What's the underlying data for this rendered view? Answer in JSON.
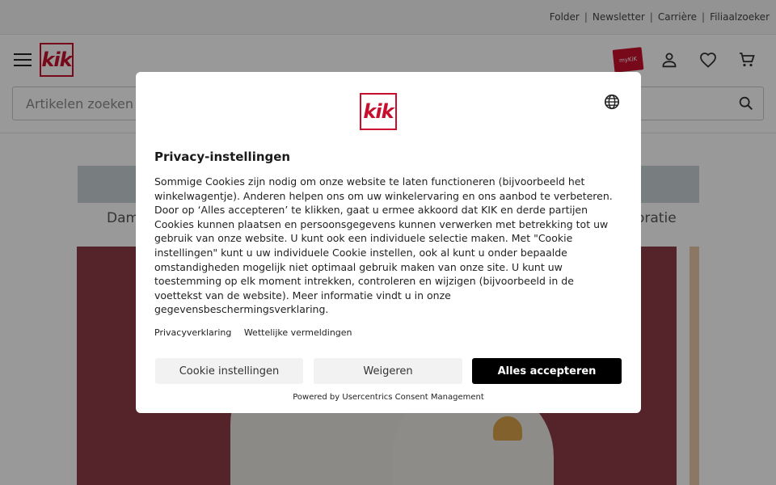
{
  "topbar": {
    "links": [
      "Folder",
      "Newsletter",
      "Carrière",
      "Filiaalzoeker"
    ],
    "separator": "|"
  },
  "header": {
    "logo_text": "kik",
    "promo_badge_text": "myKiK",
    "search_placeholder": "Artikelen zoeken",
    "icons": [
      "menu-icon",
      "account-icon",
      "heart-icon",
      "cart-icon",
      "search-icon"
    ]
  },
  "categories": {
    "left_label": "Dam",
    "right_label": "oratie"
  },
  "colors": {
    "brand_red": "#c8102e",
    "hero_background": "#8e3b47",
    "accept_button": "#000000",
    "secondary_button": "#f2f2f2"
  },
  "consent": {
    "logo_text": "kik",
    "title": "Privacy-instellingen",
    "body": "Sommige Cookies zijn nodig om onze website te laten functioneren (bijvoorbeeld het winkelwagentje). Anderen helpen ons om uw winkelervaring en ons aanbod te verbeteren. Door op ‘Alles accepteren’ te klikken, gaat u ermee akkoord dat KIK en derde partijen Cookies kunnen plaatsen en persoonsgegevens kunnen verwerken met betrekking tot uw gebruik van onze website. U kunt ook een individuele selectie maken. Met \"Cookie instellingen\" kunt u uw individuele Cookie instellen, ook al kunt u onder bepaalde omstandigheden mogelijk niet optimaal gebruik maken van onze site. U kunt uw toestemming op elk moment intrekken, controleren en wijzigen (bijvoorbeeld in de voettekst van de website). Meer informatie vindt u in onze gegevensbeschermingsverklaring.",
    "links": [
      "Privacyverklaring",
      "Wettelijke vermeldingen"
    ],
    "buttons": {
      "settings": "Cookie instellingen",
      "deny": "Weigeren",
      "accept": "Alles accepteren"
    },
    "powered_by": "Powered by Usercentrics Consent Management"
  }
}
